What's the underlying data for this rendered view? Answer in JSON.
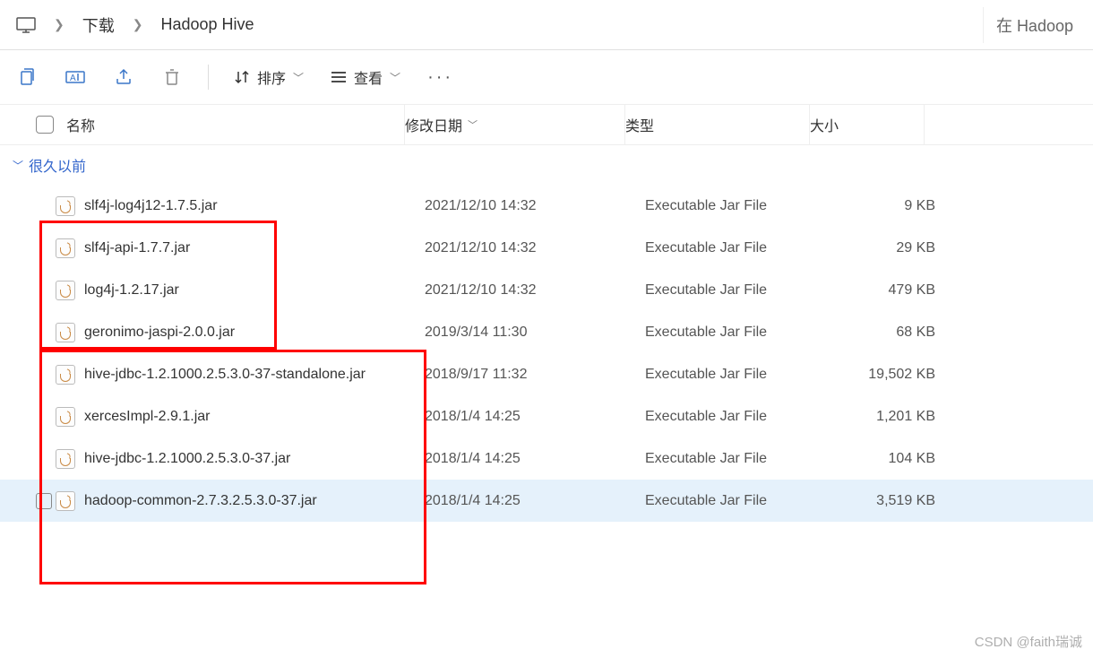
{
  "breadcrumb": {
    "items": [
      "下载",
      "Hadoop Hive"
    ]
  },
  "search": {
    "placeholder_prefix": "在 Hadoop"
  },
  "toolbar": {
    "sort_label": "排序",
    "view_label": "查看"
  },
  "columns": {
    "name": "名称",
    "date": "修改日期",
    "type": "类型",
    "size": "大小"
  },
  "group": {
    "label": "很久以前"
  },
  "rows": [
    {
      "name": "slf4j-log4j12-1.7.5.jar",
      "date": "2021/12/10 14:32",
      "type": "Executable Jar File",
      "size": "9 KB",
      "selected": false
    },
    {
      "name": "slf4j-api-1.7.7.jar",
      "date": "2021/12/10 14:32",
      "type": "Executable Jar File",
      "size": "29 KB",
      "selected": false
    },
    {
      "name": "log4j-1.2.17.jar",
      "date": "2021/12/10 14:32",
      "type": "Executable Jar File",
      "size": "479 KB",
      "selected": false
    },
    {
      "name": "geronimo-jaspi-2.0.0.jar",
      "date": "2019/3/14 11:30",
      "type": "Executable Jar File",
      "size": "68 KB",
      "selected": false
    },
    {
      "name": "hive-jdbc-1.2.1000.2.5.3.0-37-standalone.jar",
      "date": "2018/9/17 11:32",
      "type": "Executable Jar File",
      "size": "19,502 KB",
      "selected": false
    },
    {
      "name": "xercesImpl-2.9.1.jar",
      "date": "2018/1/4 14:25",
      "type": "Executable Jar File",
      "size": "1,201 KB",
      "selected": false
    },
    {
      "name": "hive-jdbc-1.2.1000.2.5.3.0-37.jar",
      "date": "2018/1/4 14:25",
      "type": "Executable Jar File",
      "size": "104 KB",
      "selected": false
    },
    {
      "name": "hadoop-common-2.7.3.2.5.3.0-37.jar",
      "date": "2018/1/4 14:25",
      "type": "Executable Jar File",
      "size": "3,519 KB",
      "selected": true
    }
  ],
  "watermark": "CSDN @faith瑞诚"
}
